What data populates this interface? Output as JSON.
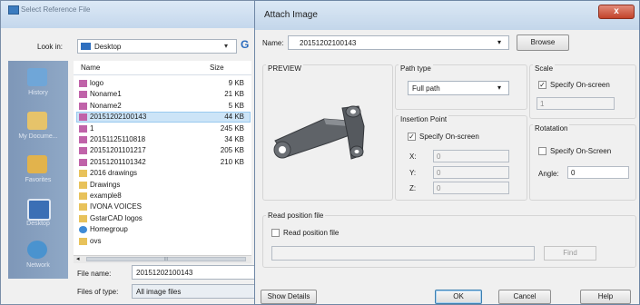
{
  "background_dialog": {
    "title": "Select Reference File",
    "look_in_label": "Look in:",
    "look_in_value": "Desktop",
    "places": [
      {
        "label": "History",
        "icon": "history-icon"
      },
      {
        "label": "My Docume...",
        "icon": "my-documents-icon"
      },
      {
        "label": "Favorites",
        "icon": "favorites-icon"
      },
      {
        "label": "Desktop",
        "icon": "desktop-icon"
      },
      {
        "label": "Network",
        "icon": "network-icon"
      }
    ],
    "columns": {
      "name": "Name",
      "size": "Size"
    },
    "files": [
      {
        "name": "logo",
        "size": "9 KB",
        "type": "image"
      },
      {
        "name": "Noname1",
        "size": "21 KB",
        "type": "image"
      },
      {
        "name": "Noname2",
        "size": "5 KB",
        "type": "image"
      },
      {
        "name": "20151202100143",
        "size": "44 KB",
        "type": "image",
        "selected": true
      },
      {
        "name": "1",
        "size": "245 KB",
        "type": "image"
      },
      {
        "name": "20151125110818",
        "size": "34 KB",
        "type": "image"
      },
      {
        "name": "20151201101217",
        "size": "205 KB",
        "type": "image"
      },
      {
        "name": "20151201101342",
        "size": "210 KB",
        "type": "image"
      },
      {
        "name": "2016 drawings",
        "size": "",
        "type": "folder"
      },
      {
        "name": "Drawings",
        "size": "",
        "type": "folder"
      },
      {
        "name": "example8",
        "size": "",
        "type": "folder"
      },
      {
        "name": "IVONA VOICES",
        "size": "",
        "type": "folder"
      },
      {
        "name": "GstarCAD logos",
        "size": "",
        "type": "folder"
      },
      {
        "name": "Homegroup",
        "size": "",
        "type": "homegroup"
      },
      {
        "name": "ovs",
        "size": "",
        "type": "folder"
      }
    ],
    "scroll_glyph": "III",
    "file_name_label": "File name:",
    "file_name_value": "20151202100143",
    "file_type_label": "Files of type:",
    "file_type_value": "All image files"
  },
  "attach_image": {
    "title": "Attach Image",
    "close_glyph": "x",
    "name_label": "Name:",
    "name_value": "20151202100143",
    "browse_label": "Browse",
    "preview_label": "PREVIEW",
    "path_type_label": "Path type",
    "path_type_value": "Full path",
    "insertion_point_label": "Insertion Point",
    "insertion_specify_label": "Specify On-screen",
    "insertion_specify_checked": true,
    "x_label": "X:",
    "x_value": "0",
    "y_label": "Y:",
    "y_value": "0",
    "z_label": "Z:",
    "z_value": "0",
    "scale_label": "Scale",
    "scale_specify_label": "Specify On-screen",
    "scale_specify_checked": true,
    "scale_value": "1",
    "rotation_label": "Rotatation",
    "rotation_specify_label": "Specify On-Screen",
    "rotation_specify_checked": false,
    "angle_label": "Angle:",
    "angle_value": "0",
    "read_position_group_label": "Read position file",
    "read_position_check_label": "Read position file",
    "read_position_checked": false,
    "find_label": "Find",
    "show_details_label": "Show Details",
    "ok_label": "OK",
    "cancel_label": "Cancel",
    "help_label": "Help"
  },
  "colors": {
    "title_bar": "#c3d6ea",
    "close_button": "#c2432a",
    "places_bar": "#8fa8c6",
    "selection": "#cce4f7"
  }
}
